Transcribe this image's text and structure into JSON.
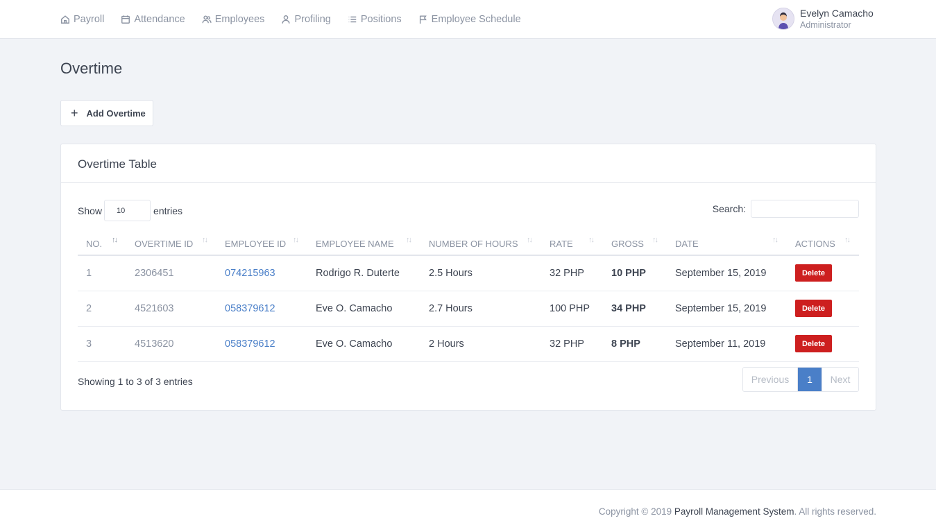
{
  "nav": {
    "items": [
      {
        "label": "Payroll",
        "icon": "home-icon"
      },
      {
        "label": "Attendance",
        "icon": "calendar-icon"
      },
      {
        "label": "Employees",
        "icon": "users-icon"
      },
      {
        "label": "Profiling",
        "icon": "user-icon"
      },
      {
        "label": "Positions",
        "icon": "list-icon"
      },
      {
        "label": "Employee Schedule",
        "icon": "flag-icon"
      }
    ]
  },
  "user": {
    "name": "Evelyn Camacho",
    "role": "Administrator"
  },
  "page": {
    "title": "Overtime",
    "add_button": "Add Overtime"
  },
  "card": {
    "title": "Overtime Table",
    "show_label": "Show",
    "entries_value": "10",
    "entries_label": "entries",
    "search_label": "Search:",
    "search_value": ""
  },
  "table": {
    "headers": [
      "NO.",
      "OVERTIME ID",
      "EMPLOYEE ID",
      "EMPLOYEE NAME",
      "NUMBER OF HOURS",
      "RATE",
      "GROSS",
      "DATE",
      "ACTIONS"
    ],
    "rows": [
      {
        "no": "1",
        "overtime_id": "2306451",
        "employee_id": "074215963",
        "name": "Rodrigo R. Duterte",
        "hours": "2.5 Hours",
        "rate": "32 PHP",
        "gross": "10 PHP",
        "date": "September 15, 2019",
        "action": "Delete"
      },
      {
        "no": "2",
        "overtime_id": "4521603",
        "employee_id": "058379612",
        "name": "Eve O. Camacho",
        "hours": "2.7 Hours",
        "rate": "100 PHP",
        "gross": "34 PHP",
        "date": "September 15, 2019",
        "action": "Delete"
      },
      {
        "no": "3",
        "overtime_id": "4513620",
        "employee_id": "058379612",
        "name": "Eve O. Camacho",
        "hours": "2 Hours",
        "rate": "32 PHP",
        "gross": "8 PHP",
        "date": "September 11, 2019",
        "action": "Delete"
      }
    ],
    "info": "Showing 1 to 3 of 3 entries"
  },
  "pagination": {
    "previous": "Previous",
    "current": "1",
    "next": "Next"
  },
  "footer": {
    "prefix": "Copyright © 2019 ",
    "brand": "Payroll Management System",
    "suffix": ". All rights reserved."
  },
  "colors": {
    "accent": "#4a7fc8",
    "danger": "#cd1f1f",
    "background": "#f1f3f7"
  }
}
